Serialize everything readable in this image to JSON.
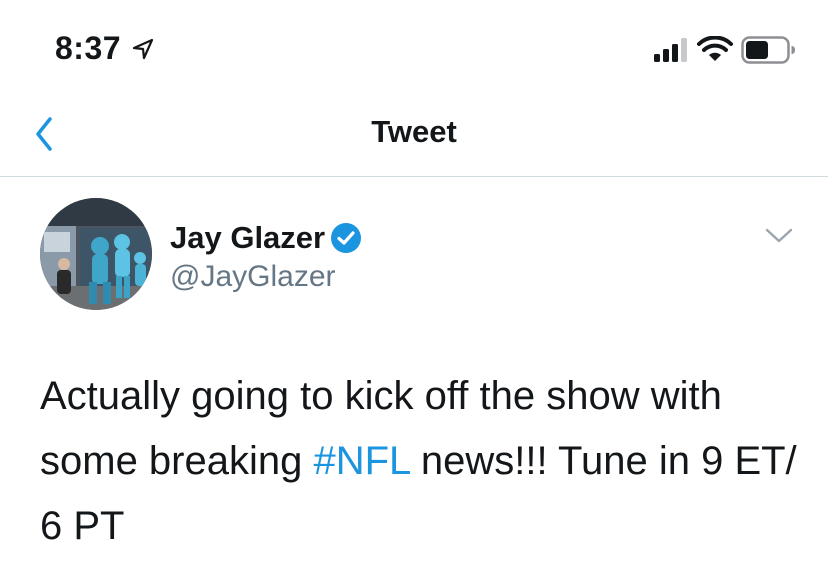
{
  "status_bar": {
    "time": "8:37",
    "icons": [
      "location-arrow-icon",
      "cellular-signal-icon",
      "wifi-icon",
      "battery-icon"
    ]
  },
  "nav": {
    "title": "Tweet",
    "back_icon": "chevron-left-icon"
  },
  "tweet": {
    "author_name": "Jay Glazer",
    "author_handle": "@JayGlazer",
    "verified": true,
    "text_part1": "Actually going to kick off the show with some breaking ",
    "hashtag": "#NFL",
    "text_part2": " news!!! Tune in 9 ET/ 6 PT"
  },
  "colors": {
    "accent": "#1b95e0",
    "handle_gray": "#657786",
    "text": "#14171a",
    "divider": "#cfd9de"
  }
}
